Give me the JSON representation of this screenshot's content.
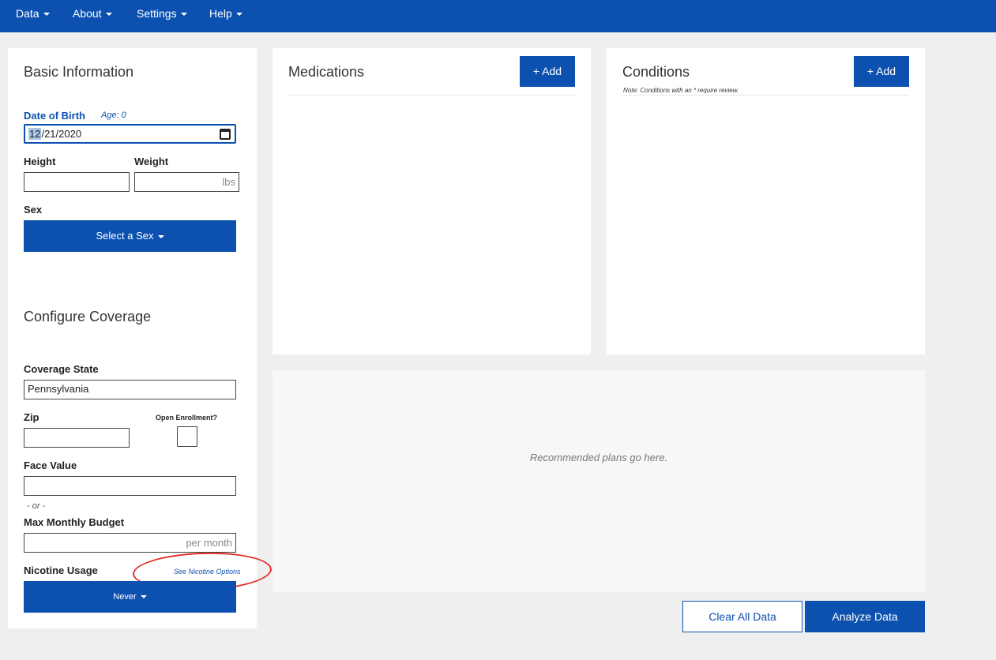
{
  "navbar": {
    "items": [
      {
        "label": "Data"
      },
      {
        "label": "About"
      },
      {
        "label": "Settings"
      },
      {
        "label": "Help"
      }
    ]
  },
  "basic_info": {
    "title": "Basic Information",
    "dob_label": "Date of Birth",
    "age_label": "Age: 0",
    "dob_month": "12",
    "dob_rest": "/21/2020",
    "height_label": "Height",
    "weight_label": "Weight",
    "weight_suffix": "lbs",
    "sex_label": "Sex",
    "sex_button": "Select a Sex"
  },
  "coverage": {
    "title": "Configure Coverage",
    "state_label": "Coverage State",
    "state_value": "Pennsylvania",
    "zip_label": "Zip",
    "open_enrollment_label": "Open Enrollment?",
    "face_value_label": "Face Value",
    "or_text": "- or -",
    "budget_label": "Max Monthly Budget",
    "budget_suffix": "per month",
    "nicotine_label": "Nicotine Usage",
    "nicotine_link": "See Nicotine Options",
    "nicotine_button": "Never"
  },
  "medications": {
    "title": "Medications",
    "add_button": "+ Add"
  },
  "conditions": {
    "title": "Conditions",
    "add_button": "+ Add",
    "note": "Note: Conditions with an * require review."
  },
  "plans": {
    "placeholder": "Recommended plans go here."
  },
  "actions": {
    "clear_label": "Clear All Data",
    "analyze_label": "Analyze Data"
  },
  "colors": {
    "brand": "#0d51b0",
    "annotation": "#e0302a"
  }
}
